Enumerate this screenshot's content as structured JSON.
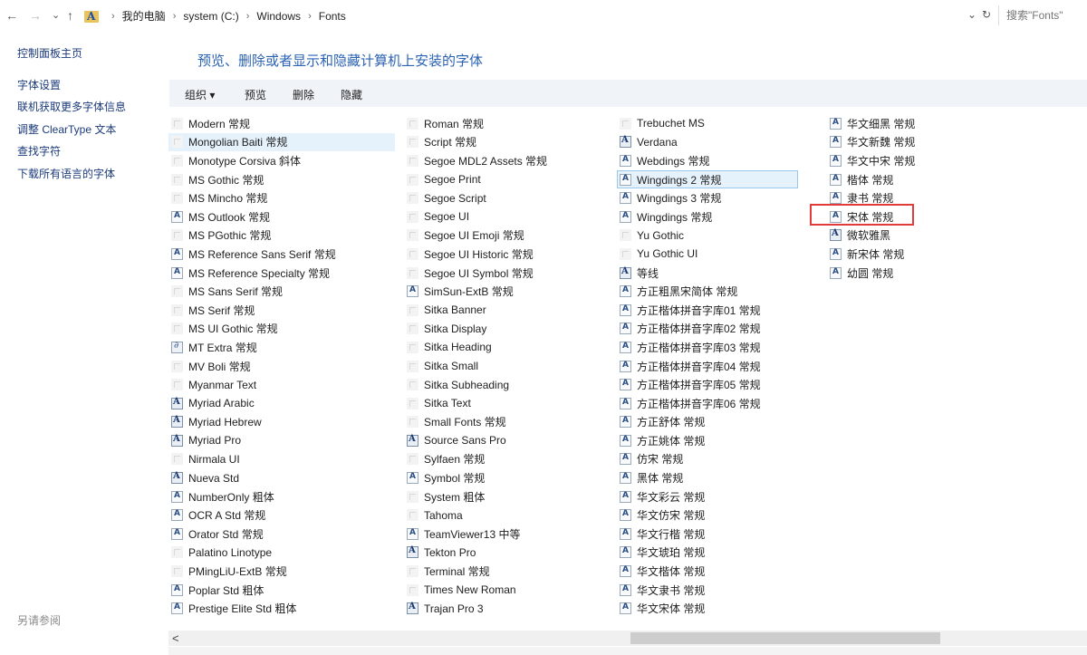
{
  "address": {
    "nav": {
      "back": "←",
      "forward": "→",
      "recent": "⌄",
      "up": "↑"
    },
    "breadcrumb": [
      "我的电脑",
      "system (C:)",
      "Windows",
      "Fonts"
    ],
    "separator": "›",
    "dropdown": "⌄",
    "refresh": "↻",
    "search_placeholder": "搜索\"Fonts\""
  },
  "sidebar": {
    "home": "控制面板主页",
    "links": [
      "字体设置",
      "联机获取更多字体信息",
      "调整 ClearType 文本",
      "查找字符",
      "下载所有语言的字体"
    ],
    "see_also": "另请参阅"
  },
  "main": {
    "title": "预览、删除或者显示和隐藏计算机上安装的字体",
    "toolbar": {
      "organize": "组织 ▾",
      "preview": "预览",
      "delete": "删除",
      "hide": "隐藏"
    }
  },
  "fonts": {
    "col1": [
      {
        "name": "Modern 常规",
        "icon": "faint"
      },
      {
        "name": "Mongolian Baiti 常规",
        "icon": "faint",
        "selected": true
      },
      {
        "name": "Monotype Corsiva 斜体",
        "icon": "faint"
      },
      {
        "name": "MS Gothic 常规",
        "icon": "faint"
      },
      {
        "name": "MS Mincho 常规",
        "icon": "faint"
      },
      {
        "name": "MS Outlook 常规",
        "icon": "A"
      },
      {
        "name": "MS PGothic 常规",
        "icon": "faint"
      },
      {
        "name": "MS Reference Sans Serif 常规",
        "icon": "A"
      },
      {
        "name": "MS Reference Specialty 常规",
        "icon": "A"
      },
      {
        "name": "MS Sans Serif 常规",
        "icon": "faint"
      },
      {
        "name": "MS Serif 常规",
        "icon": "faint"
      },
      {
        "name": "MS UI Gothic 常规",
        "icon": "faint"
      },
      {
        "name": "MT Extra 常规",
        "icon": "mt"
      },
      {
        "name": "MV Boli 常规",
        "icon": "faint"
      },
      {
        "name": "Myanmar Text",
        "icon": "faint"
      },
      {
        "name": "Myriad Arabic",
        "icon": "O"
      },
      {
        "name": "Myriad Hebrew",
        "icon": "O"
      },
      {
        "name": "Myriad Pro",
        "icon": "O"
      },
      {
        "name": "Nirmala UI",
        "icon": "faint"
      },
      {
        "name": "Nueva Std",
        "icon": "O"
      },
      {
        "name": "NumberOnly 粗体",
        "icon": "A"
      },
      {
        "name": "OCR A Std 常规",
        "icon": "A"
      },
      {
        "name": "Orator Std 常规",
        "icon": "A"
      },
      {
        "name": "Palatino Linotype",
        "icon": "faint"
      },
      {
        "name": "PMingLiU-ExtB 常规",
        "icon": "faint"
      },
      {
        "name": "Poplar Std 粗体",
        "icon": "A"
      },
      {
        "name": "Prestige Elite Std 粗体",
        "icon": "A"
      }
    ],
    "col2": [
      {
        "name": "Roman 常规",
        "icon": "faint"
      },
      {
        "name": "Script 常规",
        "icon": "faint"
      },
      {
        "name": "Segoe MDL2 Assets 常规",
        "icon": "faint"
      },
      {
        "name": "Segoe Print",
        "icon": "faint"
      },
      {
        "name": "Segoe Script",
        "icon": "faint"
      },
      {
        "name": "Segoe UI",
        "icon": "faint"
      },
      {
        "name": "Segoe UI Emoji 常规",
        "icon": "faint"
      },
      {
        "name": "Segoe UI Historic 常规",
        "icon": "faint"
      },
      {
        "name": "Segoe UI Symbol 常规",
        "icon": "faint"
      },
      {
        "name": "SimSun-ExtB 常规",
        "icon": "A"
      },
      {
        "name": "Sitka Banner",
        "icon": "faint"
      },
      {
        "name": "Sitka Display",
        "icon": "faint"
      },
      {
        "name": "Sitka Heading",
        "icon": "faint"
      },
      {
        "name": "Sitka Small",
        "icon": "faint"
      },
      {
        "name": "Sitka Subheading",
        "icon": "faint"
      },
      {
        "name": "Sitka Text",
        "icon": "faint"
      },
      {
        "name": "Small Fonts 常规",
        "icon": "faint"
      },
      {
        "name": "Source Sans Pro",
        "icon": "O"
      },
      {
        "name": "Sylfaen 常规",
        "icon": "faint"
      },
      {
        "name": "Symbol 常规",
        "icon": "A"
      },
      {
        "name": "System 粗体",
        "icon": "faint"
      },
      {
        "name": "Tahoma",
        "icon": "faint"
      },
      {
        "name": "TeamViewer13 中等",
        "icon": "A"
      },
      {
        "name": "Tekton Pro",
        "icon": "O"
      },
      {
        "name": "Terminal 常规",
        "icon": "faint"
      },
      {
        "name": "Times New Roman",
        "icon": "faint"
      },
      {
        "name": "Trajan Pro 3",
        "icon": "O"
      }
    ],
    "col3": [
      {
        "name": "Trebuchet MS",
        "icon": "faint"
      },
      {
        "name": "Verdana",
        "icon": "O"
      },
      {
        "name": "Webdings 常规",
        "icon": "A"
      },
      {
        "name": "Wingdings 2 常规",
        "icon": "A",
        "selected": true,
        "bordered": true
      },
      {
        "name": "Wingdings 3 常规",
        "icon": "A"
      },
      {
        "name": "Wingdings 常规",
        "icon": "A"
      },
      {
        "name": "Yu Gothic",
        "icon": "faint"
      },
      {
        "name": "Yu Gothic UI",
        "icon": "faint"
      },
      {
        "name": "等线",
        "icon": "O"
      },
      {
        "name": "方正粗黑宋简体 常规",
        "icon": "A"
      },
      {
        "name": "方正楷体拼音字库01 常规",
        "icon": "A"
      },
      {
        "name": "方正楷体拼音字库02 常规",
        "icon": "A"
      },
      {
        "name": "方正楷体拼音字库03 常规",
        "icon": "A"
      },
      {
        "name": "方正楷体拼音字库04 常规",
        "icon": "A"
      },
      {
        "name": "方正楷体拼音字库05 常规",
        "icon": "A"
      },
      {
        "name": "方正楷体拼音字库06 常规",
        "icon": "A"
      },
      {
        "name": "方正舒体 常规",
        "icon": "A"
      },
      {
        "name": "方正姚体 常规",
        "icon": "A"
      },
      {
        "name": "仿宋 常规",
        "icon": "A"
      },
      {
        "name": "黑体 常规",
        "icon": "A"
      },
      {
        "name": "华文彩云 常规",
        "icon": "A"
      },
      {
        "name": "华文仿宋 常规",
        "icon": "A"
      },
      {
        "name": "华文行楷 常规",
        "icon": "A"
      },
      {
        "name": "华文琥珀 常规",
        "icon": "A"
      },
      {
        "name": "华文楷体 常规",
        "icon": "A"
      },
      {
        "name": "华文隶书 常规",
        "icon": "A"
      },
      {
        "name": "华文宋体 常规",
        "icon": "A"
      }
    ],
    "col4": [
      {
        "name": "华文细黑 常规",
        "icon": "A"
      },
      {
        "name": "华文新魏 常规",
        "icon": "A"
      },
      {
        "name": "华文中宋 常规",
        "icon": "A"
      },
      {
        "name": "楷体 常规",
        "icon": "A"
      },
      {
        "name": "隶书 常规",
        "icon": "A"
      },
      {
        "name": "宋体 常规",
        "icon": "A"
      },
      {
        "name": "微软雅黑",
        "icon": "O"
      },
      {
        "name": "新宋体 常规",
        "icon": "A"
      },
      {
        "name": "幼圆 常规",
        "icon": "A"
      }
    ]
  },
  "scrollbar": {
    "left_arrow": "<"
  },
  "colors": {
    "accent_title": "#2b62b3",
    "highlight_box": "#e23b3b",
    "selection": "#e5f1fb"
  }
}
